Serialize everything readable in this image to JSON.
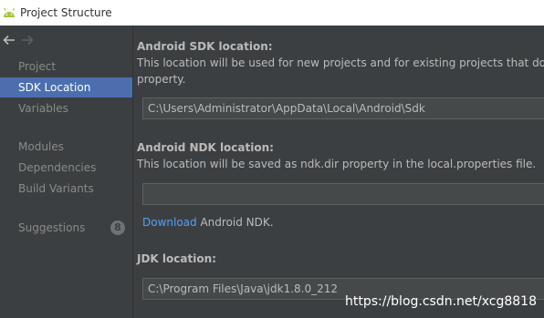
{
  "window": {
    "title": "Project Structure"
  },
  "sidebar": {
    "items": [
      {
        "label": "Project"
      },
      {
        "label": "SDK Location"
      },
      {
        "label": "Variables"
      },
      {
        "label": "Modules"
      },
      {
        "label": "Dependencies"
      },
      {
        "label": "Build Variants"
      },
      {
        "label": "Suggestions",
        "badge": "8"
      }
    ]
  },
  "sdk": {
    "heading": "Android SDK location:",
    "description_1": "This location will be used for new projects and for existing projects that do n",
    "description_2": "property.",
    "value": "C:\\Users\\Administrator\\AppData\\Local\\Android\\Sdk"
  },
  "ndk": {
    "heading": "Android NDK location:",
    "description": "This location will be saved as ndk.dir property in the local.properties file.",
    "value": "",
    "download_link": "Download",
    "download_suffix": " Android NDK."
  },
  "jdk": {
    "heading": "JDK location:",
    "value": "C:\\Program Files\\Java\\jdk1.8.0_212"
  },
  "watermark": "https://blog.csdn.net/xcg8818",
  "colors": {
    "background": "#3c3f41",
    "selection": "#4b6eaf",
    "link": "#589df6",
    "android_green": "#a4c639"
  }
}
